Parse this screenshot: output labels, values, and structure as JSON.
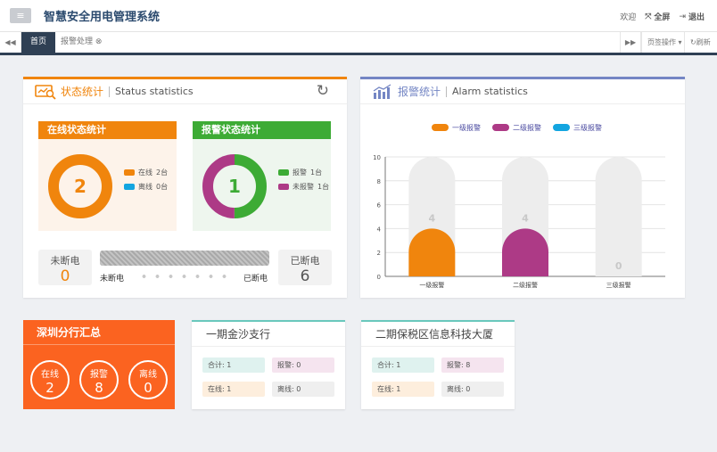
{
  "header": {
    "menu_glyph": "≡",
    "title": "智慧安全用电管理系统",
    "welcome": "欢迎",
    "fullscreen": "全屏",
    "logout": "退出"
  },
  "tabs": {
    "items": [
      {
        "label": "首页"
      },
      {
        "label": "报警处理 ⊗"
      }
    ],
    "page_ops": "页签操作 ▾",
    "refresh": "刷新"
  },
  "status_panel": {
    "title_cn": "状态统计",
    "title_en": "Status statistics",
    "online": {
      "title": "在线状态统计",
      "center": "2",
      "legend": [
        {
          "label": "在线",
          "count": "2台",
          "color": "#f0850d",
          "value": 2
        },
        {
          "label": "离线",
          "count": "0台",
          "color": "#13a5e0",
          "value": 0
        }
      ]
    },
    "alarm": {
      "title": "报警状态统计",
      "center": "1",
      "legend": [
        {
          "label": "报警",
          "count": "1台",
          "color": "#3dab35",
          "value": 1
        },
        {
          "label": "未报警",
          "count": "1台",
          "color": "#ad3a86",
          "value": 1
        }
      ]
    },
    "power": {
      "not_cut_label": "未断电",
      "not_cut_value": "0",
      "cut_label": "已断电",
      "cut_value": "6",
      "bar_left": "未断电",
      "bar_right": "已断电"
    }
  },
  "alarm_panel": {
    "title_cn": "报警统计",
    "title_en": "Alarm statistics"
  },
  "chart_data": {
    "type": "bar",
    "categories": [
      "一级报警",
      "二级报警",
      "三级报警"
    ],
    "values": [
      4,
      4,
      0
    ],
    "colors": [
      "#f0850d",
      "#ad3a86",
      "#13a5e0"
    ],
    "legend": [
      "一级报警",
      "二级报警",
      "三级报警"
    ],
    "ylim": [
      0,
      10
    ],
    "yticks": [
      "0",
      "2",
      "4",
      "6",
      "8",
      "10"
    ],
    "value_labels": [
      "4",
      "4",
      "0"
    ],
    "grid": true,
    "legend_placement": "top"
  },
  "branch": {
    "title": "深圳分行汇总",
    "items": [
      {
        "label": "在线",
        "value": "2"
      },
      {
        "label": "报警",
        "value": "8"
      },
      {
        "label": "离线",
        "value": "0"
      }
    ]
  },
  "sites": [
    {
      "title": "一期金沙支行",
      "total": "合计: 1",
      "alarm": "报警: 0",
      "online": "在线: 1",
      "offline": "离线: 0"
    },
    {
      "title": "二期保税区信息科技大厦",
      "total": "合计: 1",
      "alarm": "报警: 8",
      "online": "在线: 1",
      "offline": "离线: 0"
    }
  ]
}
